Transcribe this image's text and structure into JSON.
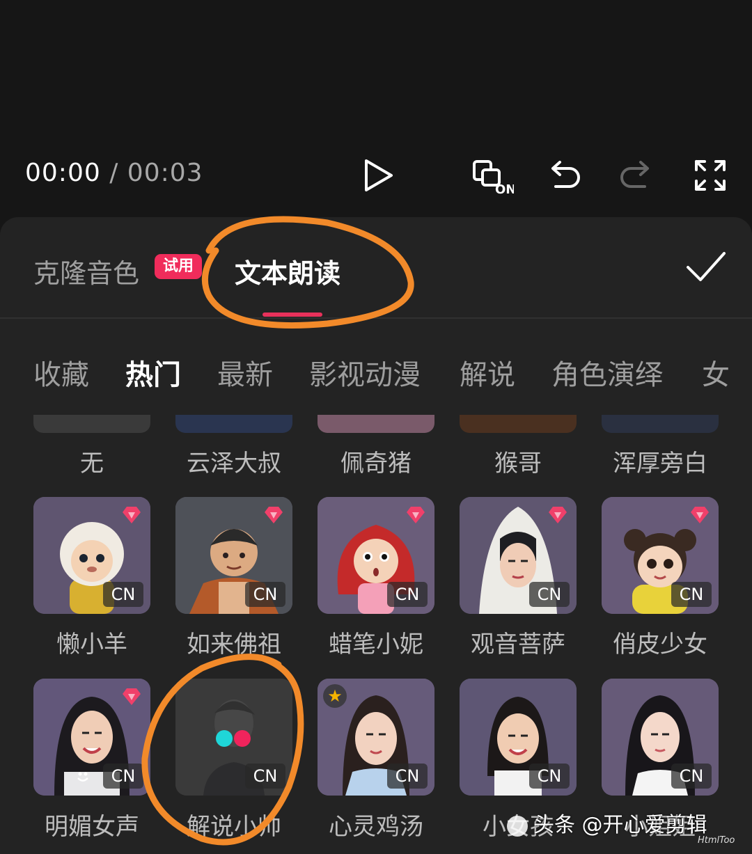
{
  "player": {
    "current_time": "00:00",
    "separator": "/",
    "duration": "00:03",
    "icons": [
      "play-icon",
      "subtitle-on-icon",
      "undo-icon",
      "redo-icon",
      "fullscreen-icon"
    ],
    "subtitle_on_text": "ON"
  },
  "panel": {
    "tabs": [
      {
        "label": "克隆音色",
        "badge": "试用",
        "active": false
      },
      {
        "label": "文本朗读",
        "active": true
      }
    ],
    "confirm_icon": "check-icon",
    "accent_color": "#e8315b"
  },
  "categories": [
    "收藏",
    "热门",
    "最新",
    "影视动漫",
    "解说",
    "角色演绎",
    "女"
  ],
  "active_category": "热门",
  "voices_top_row": [
    "无",
    "云泽大叔",
    "佩奇猪",
    "猴哥",
    "浑厚旁白"
  ],
  "voices_row2": [
    {
      "name": "懒小羊",
      "lang": "CN",
      "premium": true
    },
    {
      "name": "如来佛祖",
      "lang": "CN",
      "premium": true
    },
    {
      "name": "蜡笔小妮",
      "lang": "CN",
      "premium": true
    },
    {
      "name": "观音菩萨",
      "lang": "CN",
      "premium": true
    },
    {
      "name": "俏皮少女",
      "lang": "CN",
      "premium": true
    }
  ],
  "voices_row3": [
    {
      "name": "明媚女声",
      "lang": "CN",
      "premium": true
    },
    {
      "name": "解说小帅",
      "lang": "CN",
      "selected": true
    },
    {
      "name": "心灵鸡汤",
      "lang": "CN",
      "favorite": true
    },
    {
      "name": "小女孩",
      "lang": "CN"
    },
    {
      "name": "小姐姐",
      "lang": "CN"
    }
  ],
  "watermark": {
    "text": "头条 @开心爱剪辑",
    "small": "HtmlToo"
  }
}
